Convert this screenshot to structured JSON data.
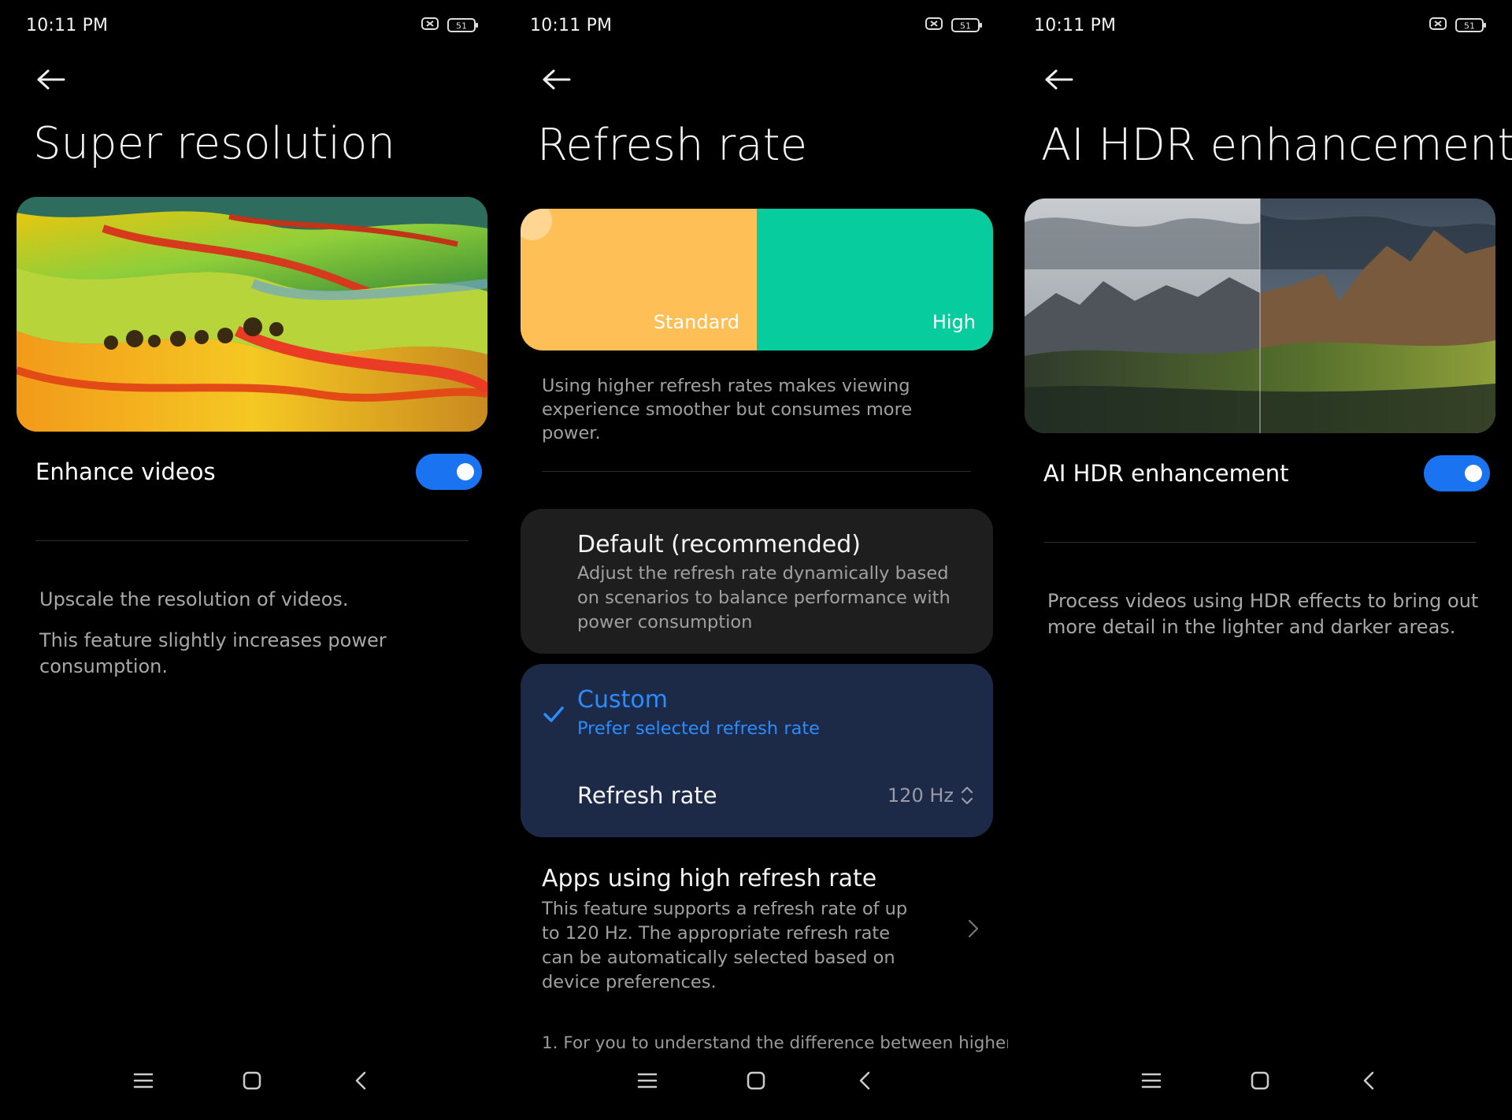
{
  "screens": [
    {
      "status": {
        "time": "10:11 PM",
        "battery": "51"
      },
      "title": "Super resolution",
      "toggle": {
        "label": "Enhance videos",
        "on": true
      },
      "descriptions": [
        "Upscale the resolution of videos.",
        "This feature slightly increases power consumption."
      ]
    },
    {
      "status": {
        "time": "10:11 PM",
        "battery": "51"
      },
      "title": "Refresh rate",
      "rate_options": {
        "standard": "Standard",
        "high": "High"
      },
      "info": "Using higher refresh rates makes viewing experience smoother but consumes more power.",
      "default_option": {
        "title": "Default (recommended)",
        "description": "Adjust the refresh rate dynamically based on scenarios to balance performance with power consumption",
        "selected": false
      },
      "custom_option": {
        "title": "Custom",
        "subtitle": "Prefer selected refresh rate",
        "selected": true,
        "refresh_rate_label": "Refresh rate",
        "refresh_rate_value": "120 Hz"
      },
      "apps": {
        "title": "Apps using high refresh rate",
        "description": "This feature supports a refresh rate of up to 120 Hz. The appropriate refresh rate can be automatically selected based on device preferences."
      },
      "footnote": "1. For you to understand the difference between higher"
    },
    {
      "status": {
        "time": "10:11 PM",
        "battery": "51"
      },
      "title": "AI HDR enhancement",
      "toggle": {
        "label": "AI HDR enhancement",
        "on": true
      },
      "description": "Process videos using HDR effects to bring out more detail in the lighter and darker areas."
    }
  ],
  "colors": {
    "accent": "#1a73f0",
    "standard": "#fdbf56",
    "high": "#07cc9e",
    "custom_card": "#1c2a47",
    "card": "#1e1e1e",
    "custom_text": "#2b8cff"
  },
  "icons": [
    "back-arrow-icon",
    "sim-off-icon",
    "battery-icon",
    "menu-icon",
    "home-icon",
    "nav-back-icon",
    "check-icon",
    "up-down-icon",
    "chevron-right-icon"
  ]
}
